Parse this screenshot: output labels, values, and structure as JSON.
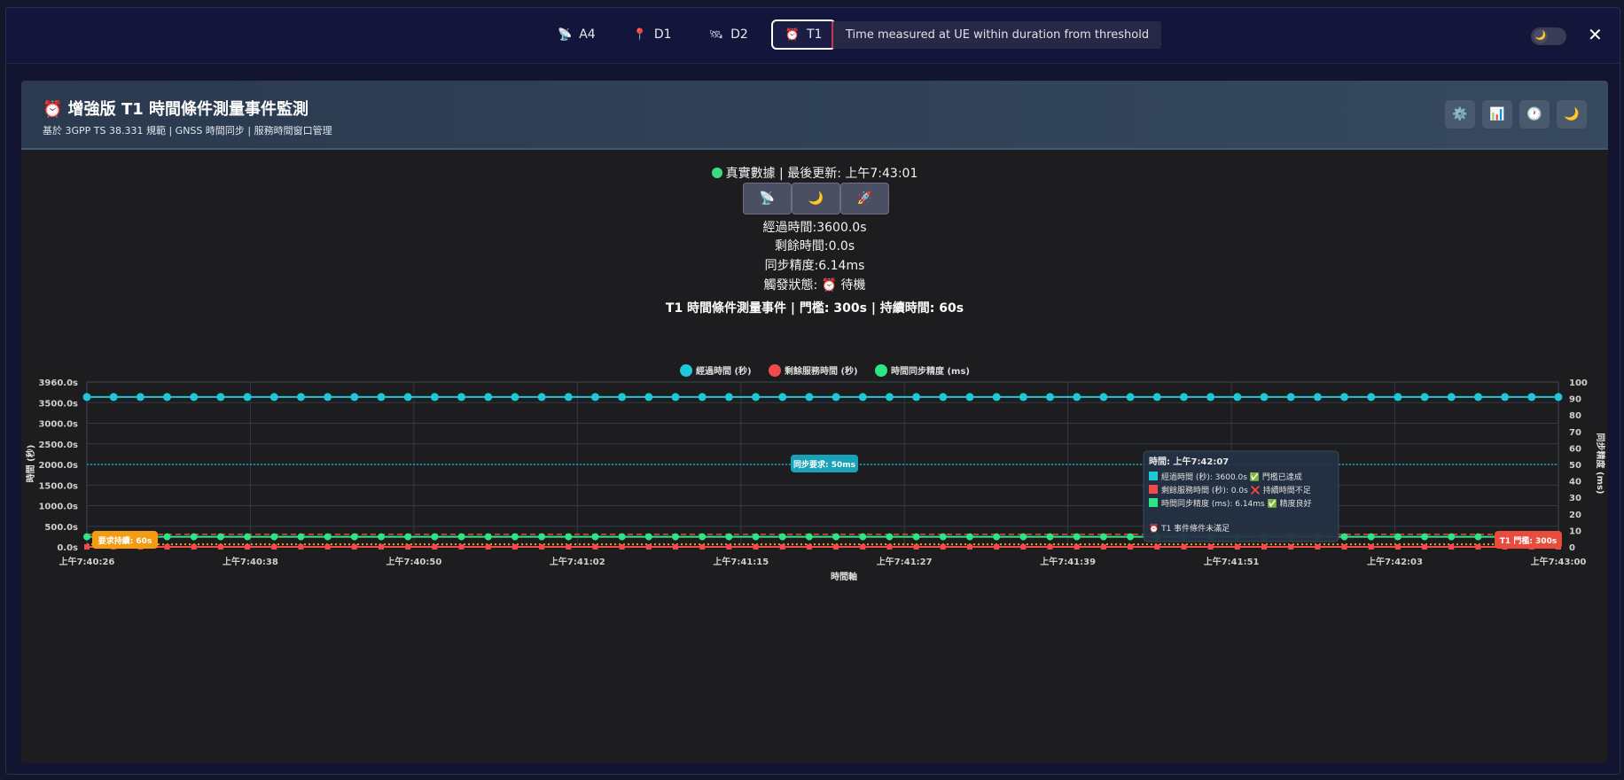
{
  "topbar": {
    "tabs": [
      {
        "label": "A4",
        "icon": "satellite-dish-icon"
      },
      {
        "label": "D1",
        "icon": "pin-icon"
      },
      {
        "label": "D2",
        "icon": "satellite-icon"
      },
      {
        "label": "T1",
        "icon": "alarm-clock-icon",
        "active": true
      }
    ],
    "tip": "Time measured at UE within duration from threshold",
    "toggle_icon": "🌙",
    "close_label": "✕"
  },
  "panel": {
    "title": "⏰ 增強版 T1 時間條件測量事件監測",
    "subtitle": "基於 3GPP TS 38.331 規範 | GNSS 時間同步 | 服務時間窗口管理",
    "header_buttons": [
      "⚙️",
      "📊",
      "🕐",
      "🌙"
    ]
  },
  "status": {
    "text": "真實數據 | 最後更新: 上午7:43:01",
    "mode_buttons": [
      "📡",
      "🌙",
      "🚀"
    ],
    "elapsed": "經過時間:3600.0s",
    "remaining": "剩餘時間:0.0s",
    "sync_accuracy": "同步精度:6.14ms",
    "trigger_state": "觸發狀態: ⏰ 待機"
  },
  "colors": {
    "elapsed": "#1ec8d8",
    "remaining": "#ef4b4b",
    "sync": "#2ee584",
    "threshold": "#e74c3c",
    "duration": "#f39c12",
    "sync_req": "#17a2b8"
  },
  "chart_data": {
    "type": "line",
    "title": "T1 時間條件測量事件 | 門檻: 300s | 持續時間: 60s",
    "xlabel": "時間軸",
    "ylabel": "時間 (秒)",
    "y2label": "同步精度 (ms)",
    "ylim": [
      0,
      3960
    ],
    "y2lim": [
      0,
      100
    ],
    "yticks": [
      "3960.0s",
      "3500.0s",
      "3000.0s",
      "2500.0s",
      "2000.0s",
      "1500.0s",
      "1000.0s",
      "500.0s",
      "0.0s"
    ],
    "y2ticks": [
      "100",
      "90",
      "80",
      "70",
      "60",
      "50",
      "40",
      "30",
      "20",
      "10",
      "0"
    ],
    "xticks": [
      "上午7:40:26",
      "上午7:40:38",
      "上午7:40:50",
      "上午7:41:02",
      "上午7:41:15",
      "上午7:41:27",
      "上午7:41:39",
      "上午7:41:51",
      "上午7:42:03",
      "上午7:43:00"
    ],
    "points": 56,
    "grid": true,
    "legend_position": "top",
    "series": [
      {
        "name": "經過時間 (秒)",
        "axis": "left",
        "value": 3600
      },
      {
        "name": "剩餘服務時間 (秒)",
        "axis": "left",
        "value": 0
      },
      {
        "name": "時間同步精度 (ms)",
        "axis": "right",
        "value": 6.14
      }
    ],
    "reference_lines": [
      {
        "label": "T1 門檻: 300s",
        "axis": "left",
        "value": 300
      },
      {
        "label": "要求持續: 60s",
        "axis": "left",
        "value": 60
      },
      {
        "label": "同步要求: 50ms",
        "axis": "right",
        "value": 50
      }
    ],
    "tooltip": {
      "title": "時間: 上午7:42:07",
      "lines": [
        "經過時間 (秒): 3600.0s ✅ 門檻已達成",
        "剩餘服務時間 (秒): 0.0s ❌ 持續時間不足",
        "時間同步精度 (ms): 6.14ms ✅ 精度良好"
      ],
      "footer": "⏰ T1 事件條件未滿足"
    }
  }
}
